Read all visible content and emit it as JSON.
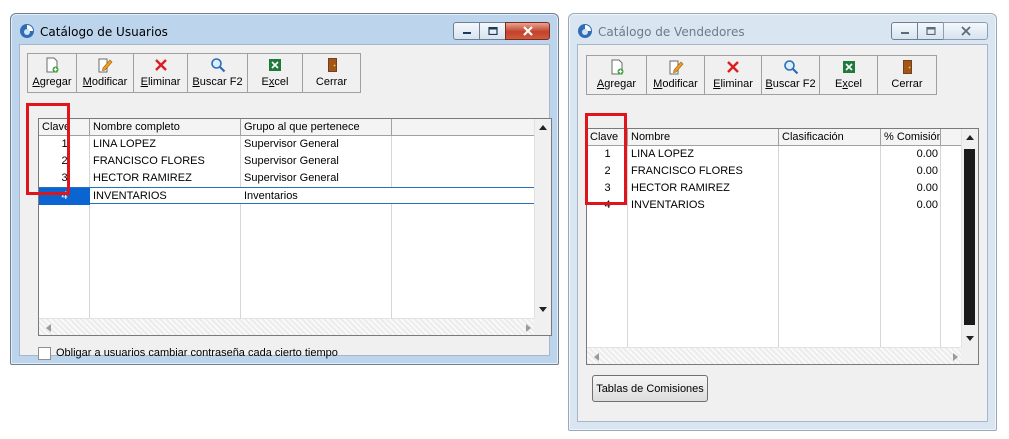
{
  "colors": {
    "selection": "#0a64d2",
    "highlight_box": "#e0141b",
    "title_active": "#bcd4ec",
    "title_inactive": "#d9e6f2"
  },
  "usuarios": {
    "title": "Catálogo de Usuarios",
    "toolbar": [
      {
        "pre": "",
        "key": "A",
        "post": "gregar",
        "icon": "add-document-icon"
      },
      {
        "pre": "",
        "key": "M",
        "post": "odificar",
        "icon": "edit-pencil-icon"
      },
      {
        "pre": "",
        "key": "E",
        "post": "liminar",
        "icon": "delete-x-icon"
      },
      {
        "pre": "",
        "key": "B",
        "post": "uscar F2",
        "icon": "search-magnifier-icon"
      },
      {
        "pre": "E",
        "key": "x",
        "post": "cel",
        "icon": "excel-icon"
      },
      {
        "pre": "",
        "key": "",
        "post": "Cerrar",
        "icon": "door-exit-icon"
      }
    ],
    "columns": [
      "Clave",
      "Nombre completo",
      "Grupo al que pertenece"
    ],
    "rows": [
      [
        "1",
        "LINA LOPEZ",
        "Supervisor General"
      ],
      [
        "2",
        "FRANCISCO FLORES",
        "Supervisor General"
      ],
      [
        "3",
        "HECTOR RAMIREZ",
        "Supervisor General"
      ],
      [
        "4",
        "INVENTARIOS",
        "Inventarios"
      ]
    ],
    "checkbox_label": "Obligar a usuarios cambiar contraseña cada cierto tiempo"
  },
  "vendedores": {
    "title": "Catálogo de Vendedores",
    "toolbar": [
      {
        "pre": "",
        "key": "A",
        "post": "gregar",
        "icon": "add-document-icon"
      },
      {
        "pre": "",
        "key": "M",
        "post": "odificar",
        "icon": "edit-pencil-icon"
      },
      {
        "pre": "",
        "key": "E",
        "post": "liminar",
        "icon": "delete-x-icon"
      },
      {
        "pre": "",
        "key": "B",
        "post": "uscar F2",
        "icon": "search-magnifier-icon"
      },
      {
        "pre": "E",
        "key": "x",
        "post": "cel",
        "icon": "excel-icon"
      },
      {
        "pre": "",
        "key": "",
        "post": "Cerrar",
        "icon": "door-exit-icon"
      }
    ],
    "columns": [
      "Clave",
      "Nombre",
      "Clasificación",
      "% Comisión"
    ],
    "rows": [
      [
        "1",
        "LINA LOPEZ",
        "",
        "0.00"
      ],
      [
        "2",
        "FRANCISCO FLORES",
        "",
        "0.00"
      ],
      [
        "3",
        "HECTOR RAMIREZ",
        "",
        "0.00"
      ],
      [
        "4",
        "INVENTARIOS",
        "",
        "0.00"
      ]
    ],
    "button_label": "Tablas de Comisiones"
  }
}
